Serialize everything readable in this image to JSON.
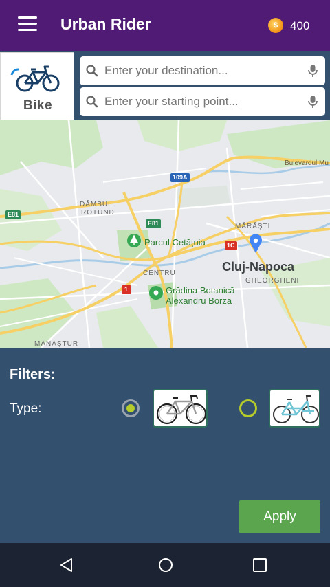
{
  "appbar": {
    "title": "Urban Rider",
    "coin_symbol": "$",
    "coin_count": "400",
    "bg_color": "#4f1b75"
  },
  "search": {
    "bike_tile_label": "Bike",
    "destination_placeholder": "Enter your destination...",
    "start_placeholder": "Enter your starting point..."
  },
  "map": {
    "labels": {
      "bulevardul": "Bulevardul Mu",
      "road_109a": "109A",
      "dambul": "DÂMBUL",
      "rotund": "ROTUND",
      "e81_left": "E81",
      "e81_mid": "E81",
      "marasti": "MĂRĂȘTI",
      "parcul": "Parcul Cetățuia",
      "road_1c": "1C",
      "cluj": "Cluj-Napoca",
      "centru": "CENTRU",
      "gheorgheni": "GHEORGHENI",
      "road_1": "1",
      "gradina_line1": "Grădina Botanică",
      "gradina_line2": "Alexandru Borza",
      "manastur": "MĂNĂȘTUR"
    }
  },
  "filters": {
    "title": "Filters:",
    "type_label": "Type:",
    "options": [
      {
        "name": "road bike",
        "selected": true
      },
      {
        "name": "city bike",
        "selected": false
      }
    ],
    "apply_label": "Apply",
    "accent_color": "#b5cc2b"
  }
}
